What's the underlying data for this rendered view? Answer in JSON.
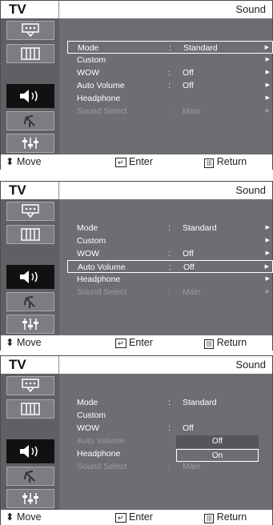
{
  "screens": [
    {
      "header": {
        "tv_label": "TV",
        "section": "Sound"
      },
      "selected_row": 0,
      "rows": [
        {
          "label": "Mode",
          "value": "Standard",
          "arrow": true,
          "colon": true,
          "dim": false
        },
        {
          "label": "Custom",
          "value": "",
          "arrow": true,
          "colon": false,
          "dim": false
        },
        {
          "label": "WOW",
          "value": "Off",
          "arrow": true,
          "colon": true,
          "dim": false
        },
        {
          "label": "Auto Volume",
          "value": "Off",
          "arrow": true,
          "colon": true,
          "dim": false
        },
        {
          "label": "Headphone",
          "value": "",
          "arrow": true,
          "colon": false,
          "dim": false
        },
        {
          "label": "Sound Select",
          "value": "Main",
          "arrow": true,
          "colon": true,
          "dim": true
        }
      ],
      "footer": {
        "move": "Move",
        "enter": "Enter",
        "return": "Return"
      }
    },
    {
      "header": {
        "tv_label": "TV",
        "section": "Sound"
      },
      "selected_row": 3,
      "rows": [
        {
          "label": "Mode",
          "value": "Standard",
          "arrow": true,
          "colon": true,
          "dim": false
        },
        {
          "label": "Custom",
          "value": "",
          "arrow": true,
          "colon": false,
          "dim": false
        },
        {
          "label": "WOW",
          "value": "Off",
          "arrow": true,
          "colon": true,
          "dim": false
        },
        {
          "label": "Auto Volume",
          "value": "Off",
          "arrow": true,
          "colon": true,
          "dim": false
        },
        {
          "label": "Headphone",
          "value": "",
          "arrow": true,
          "colon": false,
          "dim": false
        },
        {
          "label": "Sound Select",
          "value": "Main",
          "arrow": true,
          "colon": true,
          "dim": true
        }
      ],
      "footer": {
        "move": "Move",
        "enter": "Enter",
        "return": "Return"
      }
    },
    {
      "header": {
        "tv_label": "TV",
        "section": "Sound"
      },
      "selected_row": -1,
      "rows": [
        {
          "label": "Mode",
          "value": "Standard",
          "arrow": false,
          "colon": true,
          "dim": false
        },
        {
          "label": "Custom",
          "value": "",
          "arrow": false,
          "colon": false,
          "dim": false
        },
        {
          "label": "WOW",
          "value": "Off",
          "arrow": false,
          "colon": true,
          "dim": false
        },
        {
          "label": "Auto Volume",
          "value": "",
          "arrow": false,
          "colon": true,
          "dim": true
        },
        {
          "label": "Headphone",
          "value": "",
          "arrow": false,
          "colon": false,
          "dim": false
        },
        {
          "label": "Sound Select",
          "value": "Main",
          "arrow": false,
          "colon": true,
          "dim": true
        }
      ],
      "popup": {
        "options": [
          "Off",
          "On"
        ],
        "selected": 1
      },
      "footer": {
        "move": "Move",
        "enter": "Enter",
        "return": "Return"
      }
    }
  ],
  "colon_char": ":",
  "arrow_char": "▶",
  "sidebar_icons": [
    "input-icon",
    "picture-icon",
    "sound-icon",
    "channel-icon",
    "setup-icon"
  ],
  "active_icon": "sound-icon"
}
